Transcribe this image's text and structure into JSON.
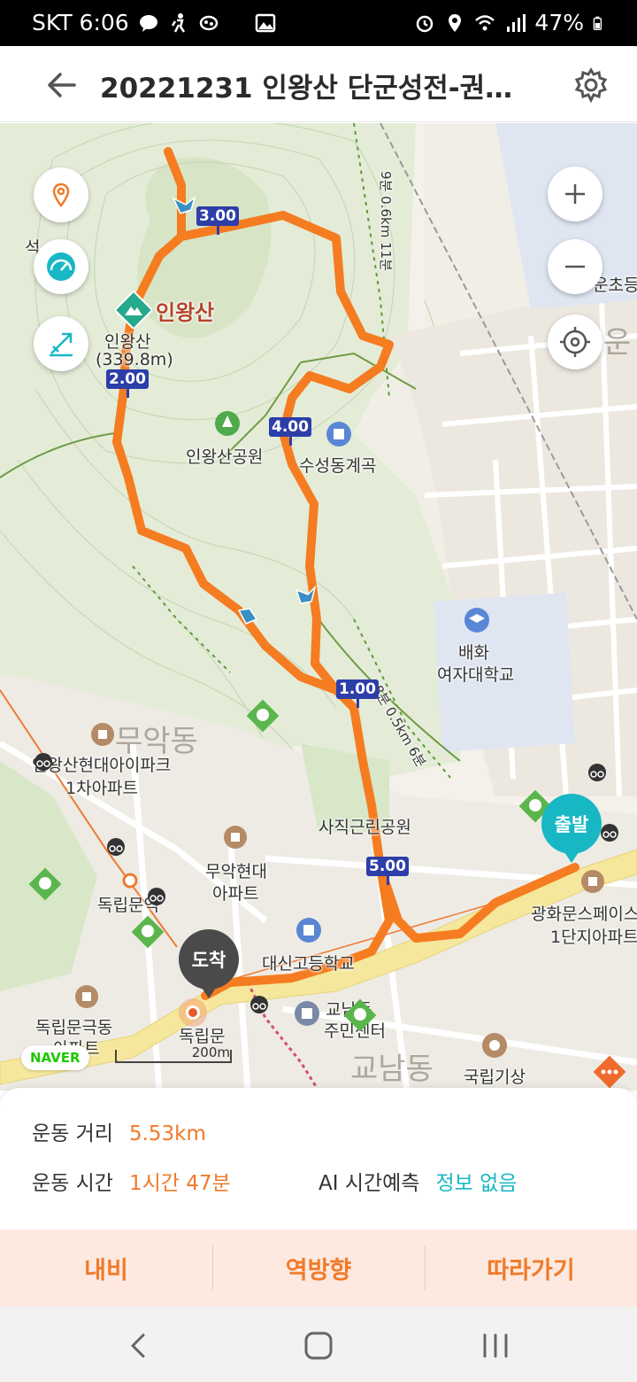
{
  "status_bar": {
    "carrier_time": "SKT 6:06",
    "battery": "47%"
  },
  "header": {
    "title": "20221231 인왕산 단군성전-권율…"
  },
  "map": {
    "labels": {
      "seok": "석",
      "peak_name": "인왕산",
      "peak_detail_1": "인왕산",
      "peak_detail_2": "(339.8m)",
      "park": "인왕산공원",
      "valley": "수성동계곡",
      "school_1": "배화",
      "school_2": "여자대학교",
      "district_muak": "무악동",
      "apt_1a": "인왕산현대아이파크",
      "apt_1b": "1차아파트",
      "sajik_park": "사직근린공원",
      "muak_apt_1": "무악현대",
      "muak_apt_2": "아파트",
      "dongnimmun_station": "독립문역",
      "space_1": "광화문스페이스",
      "space_2": "1단지아파트",
      "daeshin": "대신고등학교",
      "gyonam_1": "교남동",
      "gyonam_2": "주민센터",
      "gyonam_big": "교남동",
      "dongnim_apt_1": "독립문극동",
      "dongnim_apt_2": "아파트",
      "dongnimmun": "독립문",
      "meteo": "국립기상",
      "unchodong": "운초등",
      "oon": "운",
      "trail_1": "9분 0.6km 11분",
      "trail_2": "8분 0.5km 6분"
    },
    "km_markers": [
      "1.00",
      "2.00",
      "3.00",
      "4.00",
      "5.00"
    ],
    "start_label": "출발",
    "end_label": "도착",
    "naver_logo": "NAVER",
    "scale_label": "200m",
    "route_color": "#f57c20"
  },
  "summary": {
    "distance_label": "운동 거리",
    "distance_value": "5.53km",
    "time_label": "운동 시간",
    "time_value": "1시간 47분",
    "ai_label": "AI 시간예측",
    "ai_value": "정보 없음"
  },
  "actions": {
    "navi": "내비",
    "reverse": "역방향",
    "follow": "따라가기"
  },
  "colors": {
    "accent": "#f07a2a",
    "teal": "#17b8c4",
    "route": "#f57c20"
  }
}
